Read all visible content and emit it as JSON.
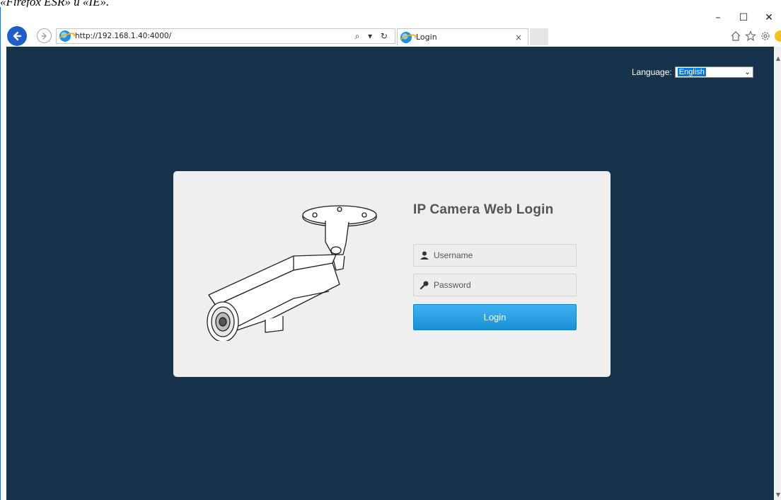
{
  "doc_caption": "«Firefox ESR» и «IE».",
  "window": {
    "controls": {
      "minimize": "–",
      "maximize": "☐",
      "close": "✕"
    }
  },
  "browser": {
    "url": "http://192.168.1.40:4000/",
    "url_tools": "⌕ ▾ ↻",
    "tab_title": "Login",
    "tab_close": "×",
    "toolbar_icons": [
      "home-icon",
      "star-icon",
      "gear-icon",
      "smiley-icon"
    ]
  },
  "page": {
    "language_label": "Language:",
    "language_value": "English",
    "login": {
      "title": "IP Camera Web Login",
      "username_placeholder": "Username",
      "password_placeholder": "Password",
      "button_label": "Login"
    }
  },
  "colors": {
    "page_bg": "#17324b",
    "panel_bg": "#efefef",
    "button": "#1a8fd6",
    "back_button": "#1e5ec6"
  }
}
